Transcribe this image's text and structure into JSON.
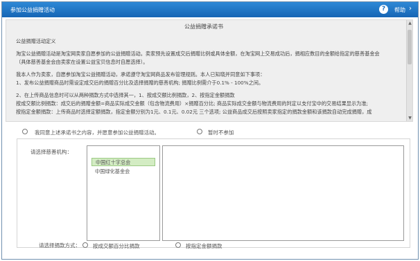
{
  "window": {
    "title": "参加公益捐赠活动",
    "help_icon": "?",
    "help_label": "帮助",
    "chevron": "›"
  },
  "pledge": {
    "title": "公益捐赠承诺书",
    "lines": [
      "公益捐赠活动定义",
      "淘宝公益捐赠活动是淘宝网卖家自愿参加的公益捐赠活动。卖家预先设置成交后捐赠比例或具体金额，在淘宝网上交易成功后，捐相应数目的金额给指定的慈善基金会",
      "（具体慈善基金会由卖家在设置公益宝贝信息时自愿选择）。",
      "我本人作为卖家，自愿参加淘宝公益捐赠活动，承诺遵守淘宝网商品发布管理规则。本人已知晓并同意如下事项：",
      "1、发布公益捐赠商品时需设定成交后的捐赠百分比及选择捐赠的慈善机构; 捐赠比例需介于0.1% - 100%之间。",
      "2、在上传商品信息时可以从两种捐款方式中选择其一，1、按成交额比例捐款，2、按指定金额捐款",
      "按成交额比例捐款：成交后的捐赠金额=商品实际成交金额（包含物流费用）×捐赠百分比; 商品实际成交金额与物流费用的判定以支付宝中的交易结果显示为准;",
      "按指定金额捐款：上传商品时选择定额捐款，指定金额分别为1元、0.1元、0.02元 三个选项; 公益商品成交后按照卖家指定的捐款金额和该捐款自动完成捐赠，成"
    ]
  },
  "agreement": {
    "agree_label": "我同意上述承诺书之内容，并愿意参加公益捐赠活动。",
    "decline_label": "暂时不参加"
  },
  "organizations": {
    "label": "请选择慈善机构：",
    "items": [
      "中国红十字总会",
      "中国绿化基金会"
    ],
    "selected_index": 0
  },
  "donation_method": {
    "label": "请选择捐款方式：",
    "options": [
      "按成交额百分比捐款",
      "按指定金额捐款"
    ]
  }
}
